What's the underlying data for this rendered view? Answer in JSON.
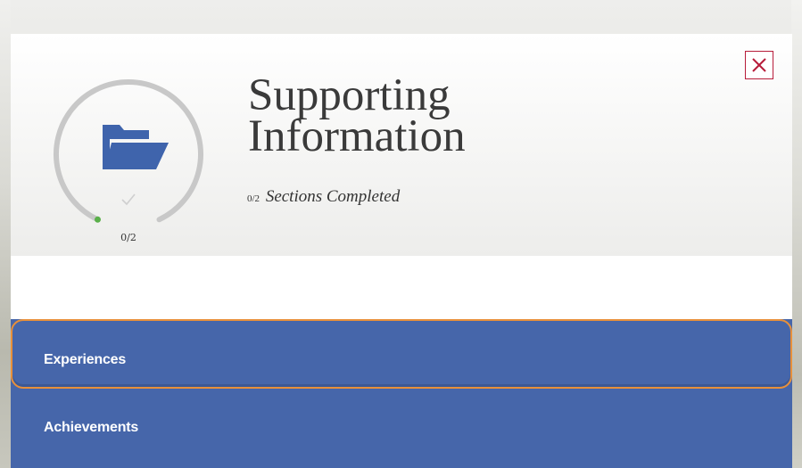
{
  "modal": {
    "title_line1": "Supporting",
    "title_line2": "Information",
    "completed_count": "0/2",
    "completed_text": "Sections Completed",
    "close_icon": "close-x-icon",
    "accent_color": "#b71c3a"
  },
  "progress": {
    "label": "0/2",
    "completed": 0,
    "total": 2,
    "fraction": 0,
    "icon": "folder-open-icon",
    "status_icon": "checkmark-icon",
    "ring_color": "#c8c8c8",
    "indicator_color": "#5ab04a"
  },
  "sections": [
    {
      "label": "Experiences",
      "selected": true
    },
    {
      "label": "Achievements",
      "selected": false
    }
  ],
  "colors": {
    "section_bg": "#4666aa",
    "selected_outline": "#e8903a",
    "folder": "#3f64ac"
  }
}
